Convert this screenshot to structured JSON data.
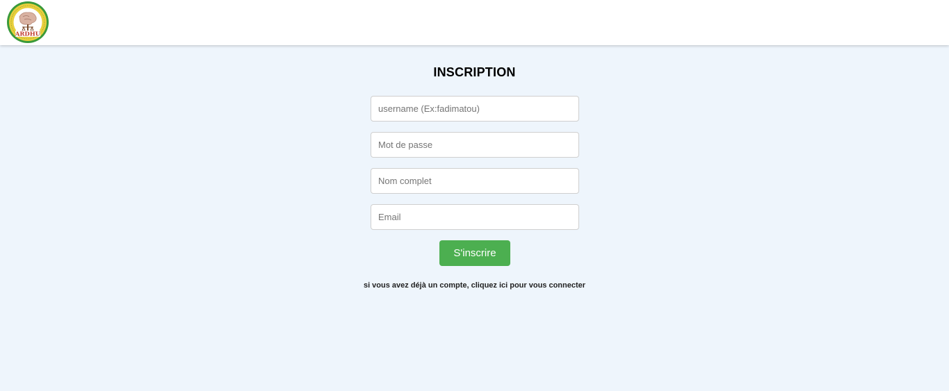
{
  "header": {
    "logo_icon": "ardhu-logo-icon",
    "logo_text": "ARDHU"
  },
  "form": {
    "title": "INSCRIPTION",
    "username": {
      "value": "",
      "placeholder": "username (Ex:fadimatou)"
    },
    "password": {
      "value": "",
      "placeholder": "Mot de passe"
    },
    "fullname": {
      "value": "",
      "placeholder": "Nom complet"
    },
    "email": {
      "value": "",
      "placeholder": "Email"
    },
    "submit_label": "S'inscrire",
    "login_link": "si vous avez déjà un compte, cliquez ici pour vous connecter"
  },
  "colors": {
    "background": "#eef5fc",
    "button": "#4caf50",
    "header_bg": "#ffffff"
  }
}
